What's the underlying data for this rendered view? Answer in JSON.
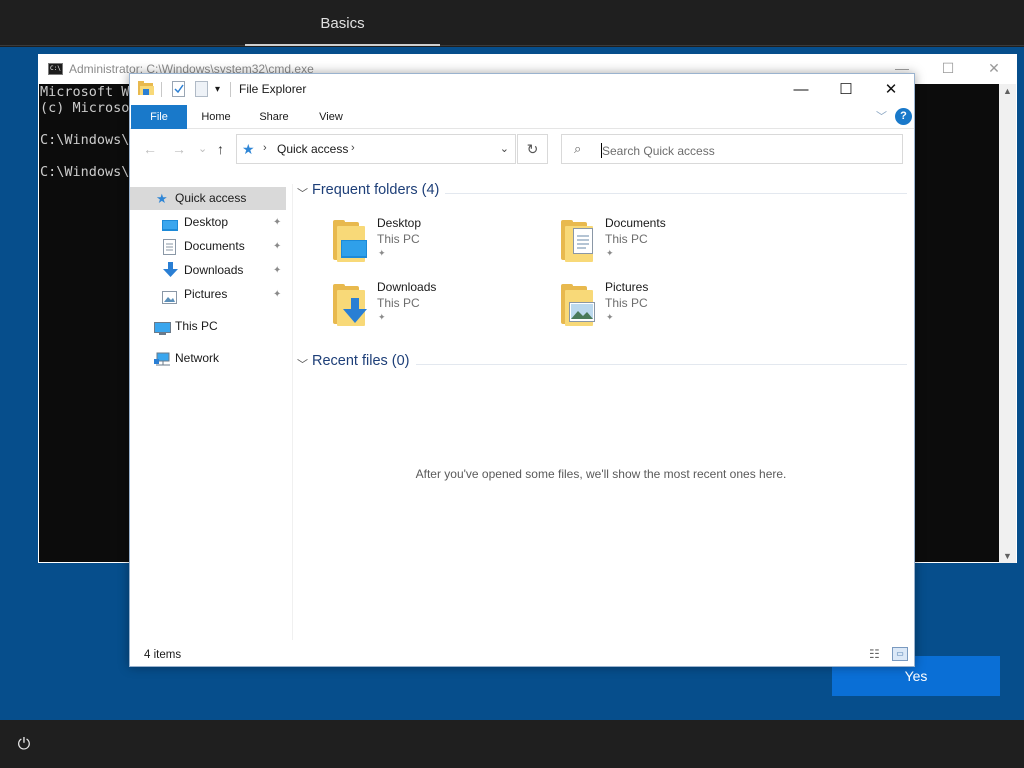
{
  "oobe": {
    "tab_label": "Basics",
    "yes_button": "Yes",
    "power_icon": "⏻"
  },
  "cmd": {
    "title": "Administrator: C:\\Windows\\system32\\cmd.exe",
    "icon_text": "C:\\",
    "lines": [
      "Microsoft W",
      "(c) Microso",
      "",
      "C:\\Windows\\",
      "",
      "C:\\Windows\\"
    ],
    "minimize": "—",
    "maximize": "☐",
    "close": "✕",
    "scroll_up": "▲",
    "scroll_down": "▼"
  },
  "explorer": {
    "title": "File Explorer",
    "caption": {
      "minimize": "—",
      "maximize": "☐",
      "close": "✕"
    },
    "ribbon": {
      "tabs": [
        "File",
        "Home",
        "Share",
        "View"
      ],
      "expand": "﹀",
      "help": "?"
    },
    "nav": {
      "back": "←",
      "forward": "→",
      "recent": "⌄",
      "up": "↑",
      "address_crumb": "Quick access",
      "address_chevron": "›",
      "address_dropdown": "⌄",
      "refresh": "↻",
      "search_placeholder": "Search Quick access"
    },
    "navpane": {
      "items": [
        {
          "label": "Quick access",
          "icon": "star-icon",
          "glyph": "★",
          "color": "#2f86d6",
          "pinned": false
        },
        {
          "label": "Desktop",
          "icon": "desktop-icon",
          "glyph": "▬",
          "color": "#1c8ad8",
          "pinned": true
        },
        {
          "label": "Documents",
          "icon": "documents-icon",
          "glyph": "▤",
          "color": "#7a8a9a",
          "pinned": true
        },
        {
          "label": "Downloads",
          "icon": "downloads-icon",
          "glyph": "⬇",
          "color": "#2a7fd4",
          "pinned": true
        },
        {
          "label": "Pictures",
          "icon": "pictures-icon",
          "glyph": "▣",
          "color": "#6a8aa8",
          "pinned": true
        },
        {
          "label": "This PC",
          "icon": "this-pc-icon",
          "glyph": "▭",
          "color": "#2a7fd4",
          "pinned": false
        },
        {
          "label": "Network",
          "icon": "network-icon",
          "glyph": "⊞",
          "color": "#2a7fd4",
          "pinned": false
        }
      ],
      "pin_glyph": "📌"
    },
    "frequent": {
      "title": "Frequent folders (4)",
      "folders": [
        {
          "name": "Desktop",
          "location": "This PC",
          "badge": "desktop-badge-icon"
        },
        {
          "name": "Documents",
          "location": "This PC",
          "badge": "documents-badge-icon"
        },
        {
          "name": "Downloads",
          "location": "This PC",
          "badge": "downloads-badge-icon"
        },
        {
          "name": "Pictures",
          "location": "This PC",
          "badge": "pictures-badge-icon"
        }
      ]
    },
    "recent": {
      "title": "Recent files (0)",
      "empty_message": "After you've opened some files, we'll show the most recent ones here."
    },
    "status": {
      "item_count": "4 items"
    }
  },
  "colors": {
    "oobe_blue": "#064e8c",
    "accent": "#1979ca",
    "folder": "#f8d978"
  }
}
